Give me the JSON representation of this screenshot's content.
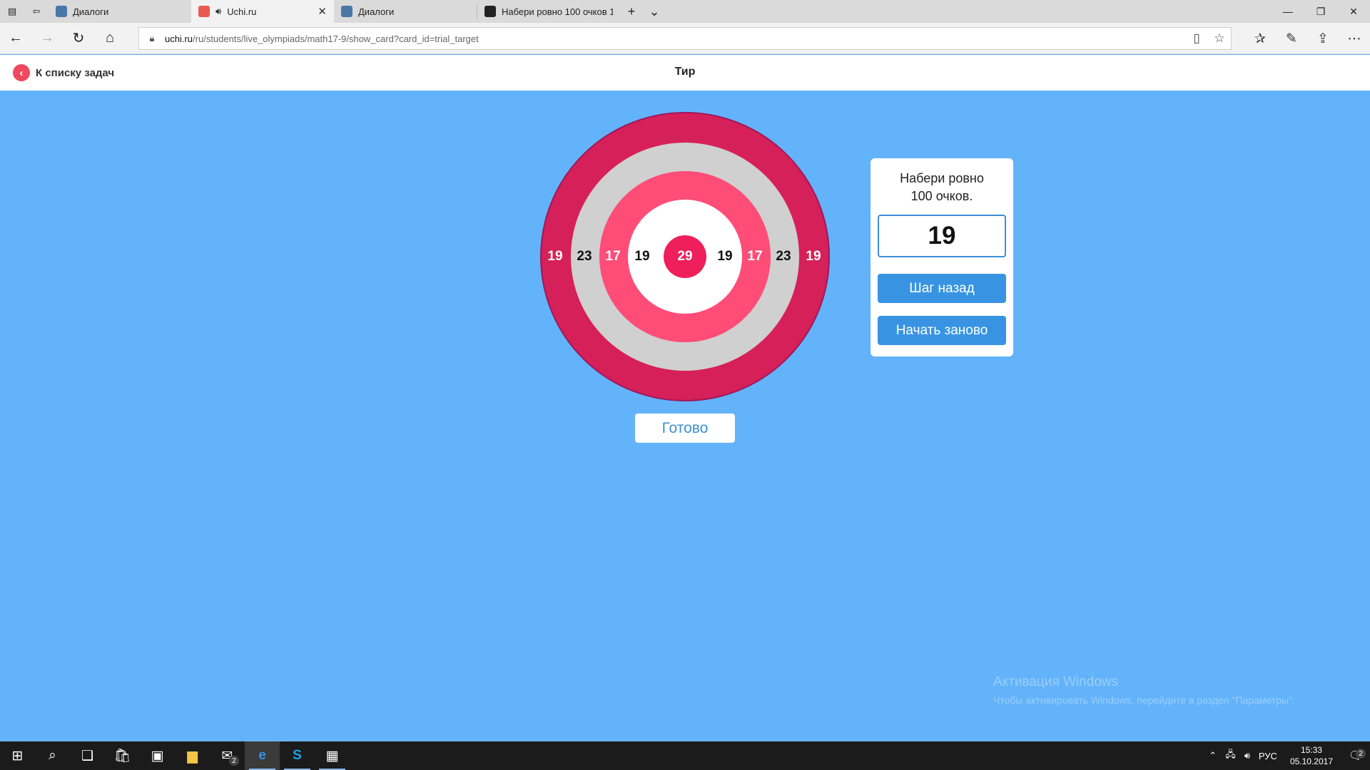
{
  "browser": {
    "tabs": [
      {
        "title": "Диалоги",
        "favicon_color": "#4a76a8",
        "active": false
      },
      {
        "title": "Uchi.ru",
        "favicon_color": "#e85a4f",
        "active": true
      },
      {
        "title": "Диалоги",
        "favicon_color": "#4a76a8",
        "active": false
      },
      {
        "title": "Набери ровно 100 очков 1",
        "favicon_color": "#222222",
        "active": false
      }
    ],
    "url_host": "uchi.ru",
    "url_path": "/ru/students/live_olympiads/math17-9/show_card?card_id=trial_target"
  },
  "header": {
    "back_label": "К списку задач",
    "title": "Тир"
  },
  "target": {
    "left_numbers": [
      "19",
      "23",
      "17",
      "19"
    ],
    "center_number": "29",
    "right_numbers": [
      "19",
      "17",
      "23",
      "19"
    ]
  },
  "done_label": "Готово",
  "panel": {
    "task_line1": "Набери ровно",
    "task_line2": "100 очков.",
    "score": "19",
    "undo_label": "Шаг назад",
    "restart_label": "Начать заново"
  },
  "watermark": {
    "line1": "Активация Windows",
    "line2": "Чтобы активировать Windows, перейдите в раздел \"Параметры\"."
  },
  "taskbar": {
    "mail_badge": "2",
    "lang": "РУС",
    "time": "15:33",
    "date": "05.10.2017",
    "notif_badge": "2"
  },
  "colors": {
    "page_bg": "#63b3fa",
    "outer_ring": "#d62059",
    "middle_ring": "#d0d0d0",
    "inner_ring": "#ff4d78",
    "bullseye": "#ee1f5a",
    "button_blue": "#3894e3",
    "back_red": "#f0485e"
  }
}
